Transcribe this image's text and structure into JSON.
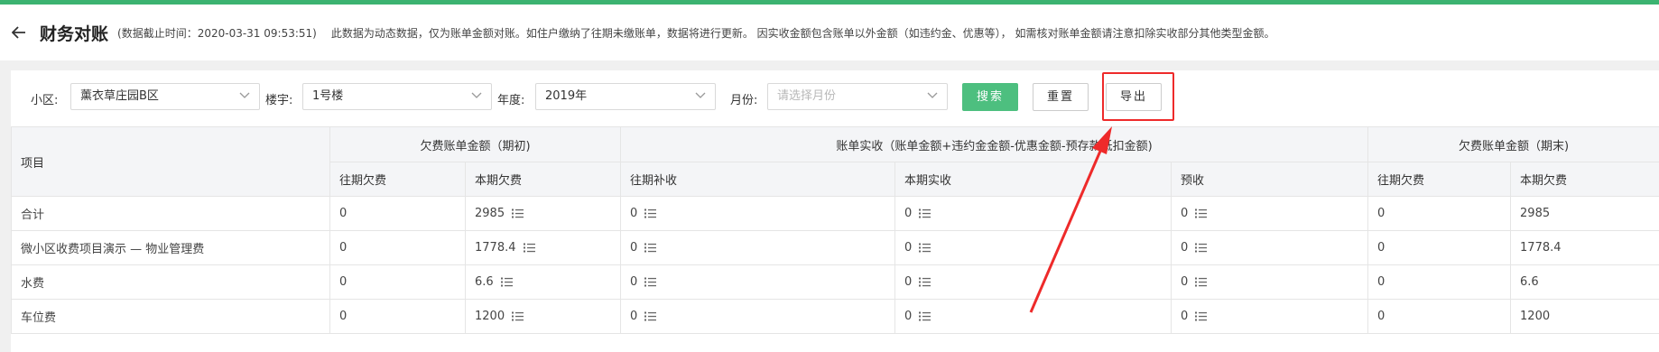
{
  "header": {
    "title": "财务对账",
    "cutoff_text": "(数据截止时间：2020-03-31 09:53:51)",
    "notice": "此数据为动态数据，仅为账单金额对账。如住户缴纳了往期未缴账单，数据将进行更新。 因实收金额包含账单以外金额（如违约金、优惠等）， 如需核对账单金额请注意扣除实收部分其他类型金额。"
  },
  "filters": {
    "community_label": "小区:",
    "community_value": "薰衣草庄园B区",
    "building_label": "楼宇:",
    "building_value": "1号楼",
    "year_label": "年度:",
    "year_value": "2019年",
    "month_label": "月份:",
    "month_placeholder": "请选择月份",
    "search_label": "搜索",
    "reset_label": "重置",
    "export_label": "导出"
  },
  "table": {
    "item_header": "项目",
    "groups": [
      "欠费账单金额（期初)",
      "账单实收（账单金额+违约金金额-优惠金额-预存款抵扣金额)",
      "欠费账单金额（期末)"
    ],
    "sub_headers": [
      "往期欠费",
      "本期欠费",
      "往期补收",
      "本期实收",
      "预收",
      "往期欠费",
      "本期欠费"
    ],
    "rows": [
      {
        "item": "合计",
        "c1": "0",
        "c2": "2985",
        "c3": "0",
        "c4": "0",
        "c5": "0",
        "c6": "0",
        "c7": "2985"
      },
      {
        "item": "微小区收费项目演示 — 物业管理费",
        "c1": "0",
        "c2": "1778.4",
        "c3": "0",
        "c4": "0",
        "c5": "0",
        "c6": "0",
        "c7": "1778.4"
      },
      {
        "item": "水费",
        "c1": "0",
        "c2": "6.6",
        "c3": "0",
        "c4": "0",
        "c5": "0",
        "c6": "0",
        "c7": "6.6"
      },
      {
        "item": "车位费",
        "c1": "0",
        "c2": "1200",
        "c3": "0",
        "c4": "0",
        "c5": "0",
        "c6": "0",
        "c7": "1200"
      }
    ]
  },
  "colors": {
    "accent_green": "#4dbf7f",
    "annotation_red": "#ee2a2a"
  },
  "icons": {
    "back": "arrow-left-icon",
    "dropdown": "chevron-down-icon",
    "detail": "list-icon"
  }
}
